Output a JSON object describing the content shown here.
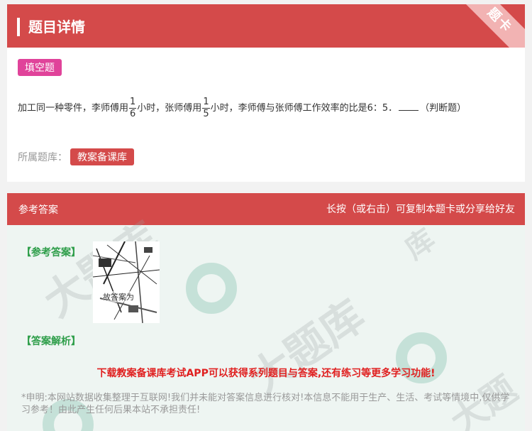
{
  "header": {
    "title": "题目详情",
    "ribbon": "题卡"
  },
  "question": {
    "type_badge": "填空题",
    "text_part1": "加工同一种零件，李师傅用",
    "frac1_num": "1",
    "frac1_den": "6",
    "text_part2": "小时，张师傅用",
    "frac2_num": "1",
    "frac2_den": "5",
    "text_part3": "小时，李师傅与张师傅工作效率的比是6：5．",
    "text_part4": "（判断题）",
    "bank_label": "所属题库：",
    "bank_tag": "教案备课库"
  },
  "answer": {
    "header_label": "参考答案",
    "header_hint": "长按（或右击）可复制本题卡或分享给好友",
    "ref_title": "【参考答案】",
    "ref_image_text": "故答案为",
    "analysis_title": "【答案解析】",
    "promo": "下载教案备课库考试APP可以获得系列题目与答案,还有练习等更多学习功能!",
    "disclaimer": "*申明:本网站数据收集整理于互联网!我们并未能对答案信息进行核对!本信息不能用于生产、生活、考试等情境中,仅供学习参考！由此产生任何后果本站不承担责任!"
  },
  "colors": {
    "accent": "#d44a4a",
    "badge": "#e0439a",
    "section": "#2e9e4a",
    "promo": "#e02020"
  }
}
